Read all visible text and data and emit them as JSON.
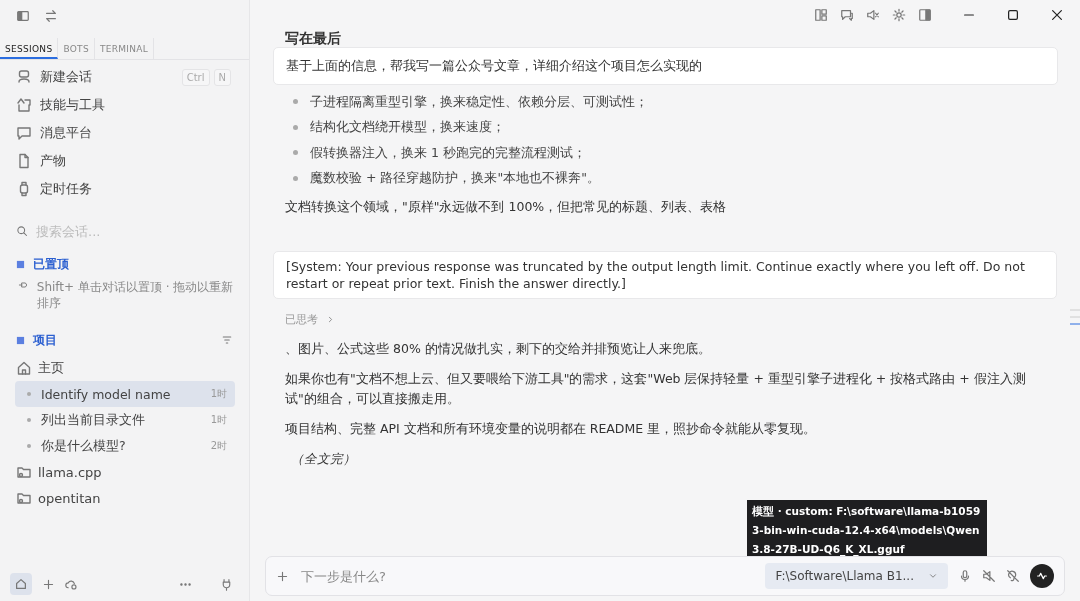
{
  "sidebar": {
    "tabs": [
      {
        "label": "SESSIONS",
        "selected": true
      },
      {
        "label": "BOTS",
        "selected": false
      },
      {
        "label": "TERMINAL",
        "selected": false
      }
    ],
    "nav": [
      {
        "label": "新建会话",
        "kind": "new",
        "shortcut": [
          "Ctrl",
          "N"
        ]
      },
      {
        "label": "技能与工具",
        "kind": "skills"
      },
      {
        "label": "消息平台",
        "kind": "chat"
      },
      {
        "label": "产物",
        "kind": "file"
      },
      {
        "label": "定时任务",
        "kind": "watch"
      }
    ],
    "search": {
      "placeholder": "搜索会话..."
    },
    "pinned": {
      "title": "已置顶",
      "hint": "Shift+ 单击对话以置顶 · 拖动以重新排序"
    },
    "projects": {
      "title": "项目",
      "items": [
        {
          "label": "主页",
          "kind": "home",
          "children": [
            {
              "label": "Identify model name",
              "time": "1时",
              "selected": true
            },
            {
              "label": "列出当前目录文件",
              "time": "1时",
              "selected": false
            },
            {
              "label": "你是什么模型?",
              "time": "2时",
              "selected": false
            }
          ]
        },
        {
          "label": "llama.cpp",
          "kind": "folder"
        },
        {
          "label": "opentitan",
          "kind": "folder"
        }
      ]
    }
  },
  "chat": {
    "heading": "写在最后",
    "sticky_prompt": "基于上面的信息，帮我写一篇公众号文章，详细介绍这个项目怎么实现的",
    "bullets": [
      "子进程隔离重型引擎，换来稳定性、依赖分层、可测试性；",
      "结构化文档绕开模型，换来速度；",
      "假转换器注入，换来 1 秒跑完的完整流程测试；",
      "魔数校验 + 路径穿越防护，换来\"本地也不裸奔\"。"
    ],
    "paragraph": "文档转换这个领域，\"原样\"永远做不到 100%，但把常见的标题、列表、表格",
    "system_message": "[System: Your previous response was truncated by the output length limit. Continue exactly where you left off. Do not restart or repeat prior text. Finish the answer directly.]",
    "thinking": {
      "label": "已思考",
      "expanded": false
    },
    "paragraphs": [
      "、图片、公式这些 80% 的情况做扎实，剩下的交给并排预览让人来兜底。",
      "如果你也有\"文档不想上云、但又要喂给下游工具\"的需求，这套\"Web 层保持轻量 + 重型引擎子进程化 + 按格式路由 + 假注入测试\"的组合，可以直接搬走用。",
      "项目结构、完整 API 文档和所有环境变量的说明都在 README 里，照抄命令就能从零复现。"
    ],
    "ending": "（全文完）"
  },
  "composer": {
    "placeholder": "下一步是什么?",
    "model": "F:\\Software\\Llama B1...",
    "tooltip": "模型 · custom: F:\\software\\llama-b10593-bin-win-cuda-12.4-x64\\models\\Qwen3.8-27B-UD-Q6_K_XL.gguf"
  }
}
